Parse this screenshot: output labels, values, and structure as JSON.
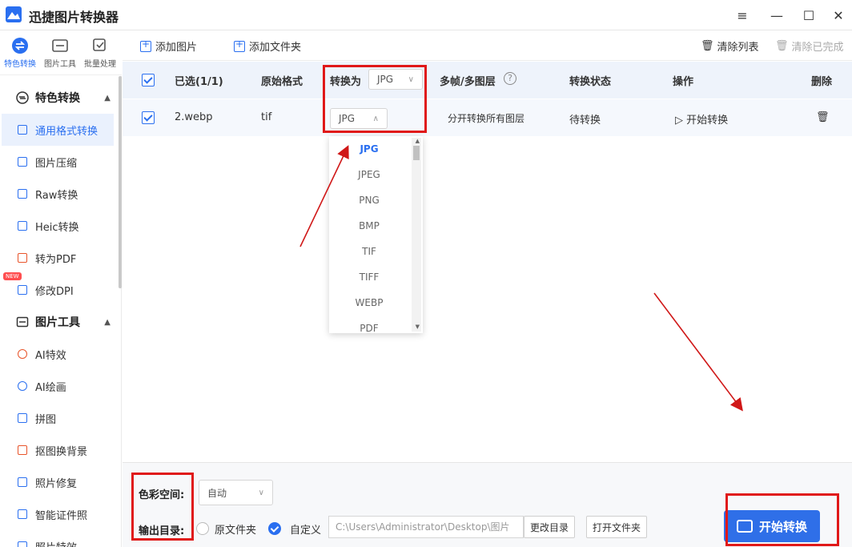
{
  "app": {
    "title": "迅捷图片转换器"
  },
  "window": {
    "menu_icon": "hamburger-icon",
    "minimize_icon": "minimize-icon",
    "maximize_icon": "maximize-icon",
    "close_icon": "close-icon"
  },
  "side_tabs": [
    {
      "label": "特色转换"
    },
    {
      "label": "图片工具"
    },
    {
      "label": "批量处理"
    }
  ],
  "sidebar": {
    "section1": "特色转换",
    "items1": [
      "通用格式转换",
      "图片压缩",
      "Raw转换",
      "Heic转换",
      "转为PDF",
      "修改DPI"
    ],
    "new_badge": "NEW",
    "section2": "图片工具",
    "items2": [
      "AI特效",
      "AI绘画",
      "拼图",
      "抠图换背景",
      "照片修复",
      "智能证件照",
      "照片特效"
    ]
  },
  "toolbar": {
    "add_image": "添加图片",
    "add_folder": "添加文件夹",
    "clear_list": "清除列表",
    "clear_done": "清除已完成"
  },
  "table": {
    "headers": {
      "selected": "已选(1/1)",
      "orig_format": "原始格式",
      "convert_to": "转换为",
      "convert_to_value": "JPG",
      "multi_frame": "多帧/多图层",
      "status": "转换状态",
      "action": "操作",
      "delete": "删除"
    },
    "rows": [
      {
        "name": "2.webp",
        "orig": "tif",
        "target": "JPG",
        "frames": "分开转换所有图层",
        "status": "待转换",
        "action": "开始转换"
      }
    ]
  },
  "dropdown": {
    "options": [
      "JPG",
      "JPEG",
      "PNG",
      "BMP",
      "TIF",
      "TIFF",
      "WEBP",
      "PDF"
    ],
    "selected": "JPG"
  },
  "bottom": {
    "color_space_label": "色彩空间:",
    "color_space_value": "自动",
    "output_label": "输出目录:",
    "opt_original": "原文件夹",
    "opt_custom": "自定义",
    "path": "C:\\Users\\Administrator\\Desktop\\图片",
    "change_dir": "更改目录",
    "open_folder": "打开文件夹",
    "start": "开始转换"
  },
  "colors": {
    "accent": "#2a6ff0",
    "annotation": "#e01818",
    "header_bg": "#eef3fb"
  }
}
